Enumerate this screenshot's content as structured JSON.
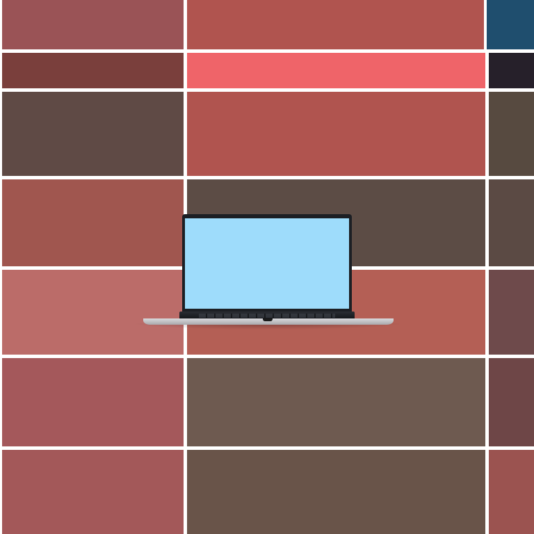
{
  "scene": {
    "background_color": "#ffffff",
    "tiles": [
      {
        "color": "#9a5356"
      },
      {
        "color": "#b0544f"
      },
      {
        "color": "#1f4e6e"
      },
      {
        "color": "#7a3f3c"
      },
      {
        "color": "#ef6469"
      },
      {
        "color": "#26202a"
      },
      {
        "color": "#5f4a45"
      },
      {
        "color": "#b0544f"
      },
      {
        "color": "#574a40"
      },
      {
        "color": "#a0564f"
      },
      {
        "color": "#5c4c45"
      },
      {
        "color": "#5b4a44"
      },
      {
        "color": "#bb6c69"
      },
      {
        "color": "#b45f55"
      },
      {
        "color": "#6e4a4b"
      },
      {
        "color": "#a4585b"
      },
      {
        "color": "#6e5a50"
      },
      {
        "color": "#6e4647"
      },
      {
        "color": "#a35859"
      },
      {
        "color": "#695449"
      },
      {
        "color": "#9b5350"
      }
    ],
    "laptop": {
      "screen_color": "#9edcfb",
      "body_color": "#1c1f24",
      "base_color": "#d9d9dc"
    }
  }
}
